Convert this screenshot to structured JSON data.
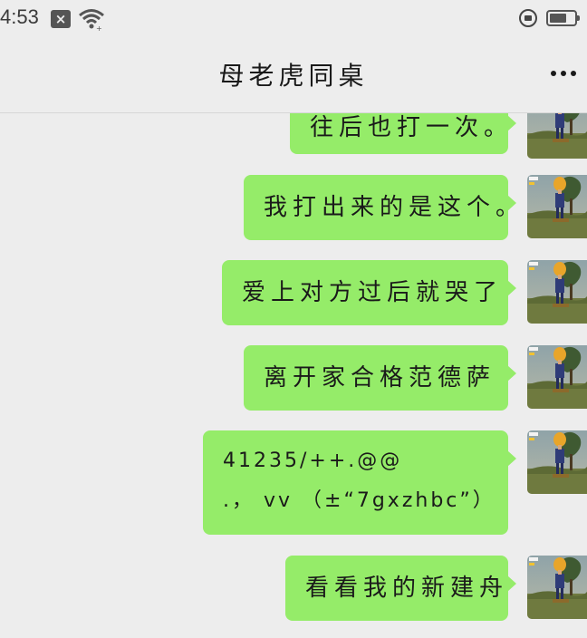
{
  "status_bar": {
    "time": "4:53",
    "icons": [
      "notification-x-icon",
      "wifi-icon",
      "rotation-lock-icon",
      "battery-icon"
    ],
    "battery_level": 0.7
  },
  "header": {
    "title": "母老虎同桌",
    "menu_icon": "more-dots-icon"
  },
  "colors": {
    "background": "#ededed",
    "bubble": "#95ec69",
    "text": "#1a1a1a"
  },
  "messages": [
    {
      "sender": "me",
      "lines": [
        "往后也打一次。"
      ]
    },
    {
      "sender": "me",
      "lines": [
        "我打出来的是这个。"
      ]
    },
    {
      "sender": "me",
      "lines": [
        "爱上对方过后就哭了"
      ]
    },
    {
      "sender": "me",
      "lines": [
        "离开家合格范德萨"
      ]
    },
    {
      "sender": "me",
      "lines": [
        "41235/++.@@",
        ".， vv （±“7gxzhbc”）"
      ]
    },
    {
      "sender": "me",
      "lines": [
        "看看我的新建舟"
      ]
    }
  ]
}
